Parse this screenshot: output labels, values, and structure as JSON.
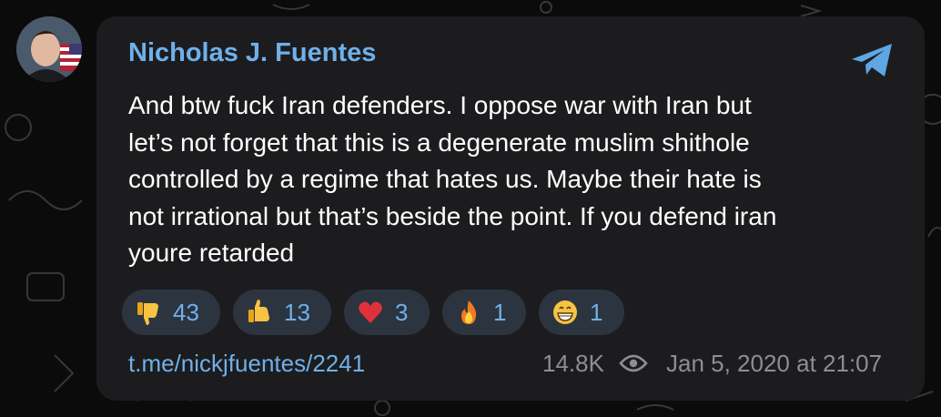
{
  "post": {
    "author": "Nicholas J. Fuentes",
    "text_lines": [
      "And btw fuck Iran defenders. I oppose war with Iran but",
      "let’s not forget that this is a degenerate muslim shithole",
      "controlled by a regime that hates us. Maybe their hate is",
      "not irrational but that’s beside the point. If you defend iran",
      "youre retarded"
    ],
    "link": "t.me/nickjfuentes/2241",
    "views": "14.8K",
    "date": "Jan 5, 2020 at 21:07"
  },
  "reactions": [
    {
      "icon": "thumbs-down-emoji",
      "count": "43"
    },
    {
      "icon": "thumbs-up-emoji",
      "count": "13"
    },
    {
      "icon": "red-heart-emoji",
      "count": "3"
    },
    {
      "icon": "fire-emoji",
      "count": "1"
    },
    {
      "icon": "grinning-face-emoji",
      "count": "1"
    }
  ],
  "colors": {
    "background": "#0b0b0c",
    "bubble": "#1c1c1e",
    "accent": "#6fb0ea",
    "text": "#ffffff",
    "muted": "#8d8e93",
    "pill": "#2c3440"
  }
}
